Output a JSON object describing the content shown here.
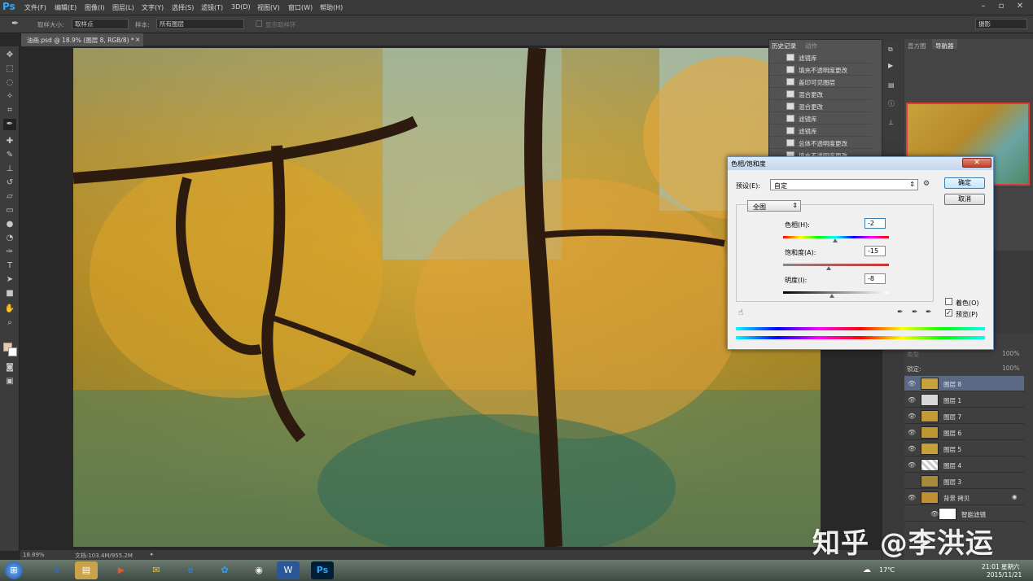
{
  "app": {
    "logo": "Ps"
  },
  "menu": [
    "文件(F)",
    "编辑(E)",
    "图像(I)",
    "图层(L)",
    "文字(Y)",
    "选择(S)",
    "滤镜(T)",
    "3D(D)",
    "视图(V)",
    "窗口(W)",
    "帮助(H)"
  ],
  "options": {
    "sample_size_label": "取样大小:",
    "sample_size_value": "取样点",
    "sample_label": "样本:",
    "sample_value": "所有图层",
    "show_ring": "显示取样环",
    "workspace": "摄影"
  },
  "document": {
    "tab_title": "油画.psd @ 18.9% (图层 8, RGB/8) *"
  },
  "status": {
    "zoom": "18.89%",
    "doc_info": "文档:103.4M/955.2M"
  },
  "history": {
    "tabs": [
      "历史记录",
      "动作"
    ],
    "items": [
      "滤镜库",
      "填充不透明度更改",
      "盖印可见图层",
      "混合更改",
      "混合更改",
      "滤镜库",
      "滤镜库",
      "总体不透明度更改",
      "填充不透明度更改"
    ]
  },
  "nav_tabs": [
    "直方图",
    "导航器"
  ],
  "dialog": {
    "title": "色相/饱和度",
    "close": "✕",
    "preset_label": "预设(E):",
    "preset_value": "自定",
    "ok": "确定",
    "cancel": "取消",
    "channel": "全图",
    "hue_label": "色相(H):",
    "hue_value": "-2",
    "sat_label": "饱和度(A):",
    "sat_value": "-15",
    "light_label": "明度(I):",
    "light_value": "-8",
    "colorize": "着色(O)",
    "preview": "预览(P)",
    "preview_checked": true,
    "colorize_checked": false
  },
  "layers": {
    "header": "锁定:",
    "fill": "100%",
    "opacity": "100%",
    "kind": "类型",
    "items": [
      {
        "name": "图层 8"
      },
      {
        "name": "图层 1"
      },
      {
        "name": "图层 7"
      },
      {
        "name": "图层 6"
      },
      {
        "name": "图层 5"
      },
      {
        "name": "图层 4"
      },
      {
        "name": "图层 3"
      },
      {
        "name": "背景 拷贝"
      },
      {
        "name": "智能滤镜"
      }
    ]
  },
  "taskbar": {
    "weather": "17℃",
    "time": "21:01 星期六",
    "date": "2015/11/21"
  },
  "watermark": "知乎 @李洪运"
}
